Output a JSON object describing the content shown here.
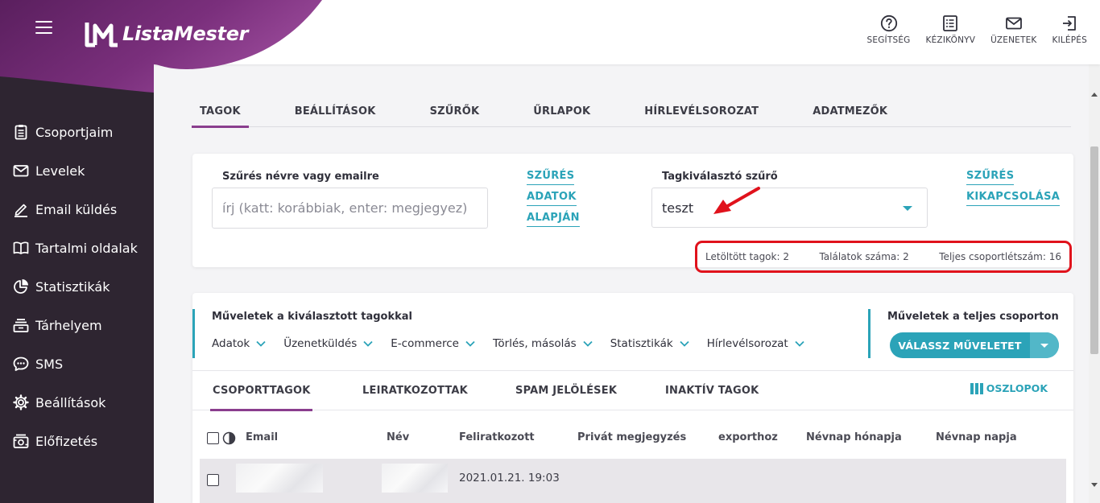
{
  "brand": {
    "name": "ListaMester",
    "wave_color": "#6d2a6f",
    "accent": "#2ba3b8",
    "tab_accent": "#8a3e8e"
  },
  "top_actions": [
    {
      "label": "SEGÍTSÉG",
      "icon": "help-circle-icon"
    },
    {
      "label": "KÉZIKÖNYV",
      "icon": "manual-icon"
    },
    {
      "label": "ÜZENETEK",
      "icon": "envelope-icon"
    },
    {
      "label": "KILÉPÉS",
      "icon": "logout-icon"
    }
  ],
  "sidebar": {
    "items": [
      {
        "label": "Csoportjaim",
        "icon": "clipboard-icon"
      },
      {
        "label": "Levelek",
        "icon": "mail-icon"
      },
      {
        "label": "Email küldés",
        "icon": "pen-icon"
      },
      {
        "label": "Tartalmi oldalak",
        "icon": "book-icon"
      },
      {
        "label": "Statisztikák",
        "icon": "pie-chart-icon"
      },
      {
        "label": "Tárhelyem",
        "icon": "storage-icon"
      },
      {
        "label": "SMS",
        "icon": "chat-bubble-icon"
      },
      {
        "label": "Beállítások",
        "icon": "gear-icon"
      },
      {
        "label": "Előfizetés",
        "icon": "subscription-icon"
      }
    ]
  },
  "main_tabs": [
    {
      "label": "TAGOK",
      "active": true
    },
    {
      "label": "BEÁLLÍTÁSOK"
    },
    {
      "label": "SZŰRŐK"
    },
    {
      "label": "ŰRLAPOK"
    },
    {
      "label": "HÍRLEVÉLSOROZAT"
    },
    {
      "label": "ADATMEZŐK"
    }
  ],
  "filter": {
    "search_label": "Szűrés névre vagy emailre",
    "search_placeholder": "írj (katt: korábbiak, enter: megjegyez)",
    "search_value": "",
    "data_filter_link": [
      "SZŰRÉS",
      "ADATOK",
      "ALAPJÁN"
    ],
    "selector_label": "Tagkiválasztó szűrő",
    "selector_value": "teszt",
    "disable_filter_link": [
      "SZŰRÉS",
      "KIKAPCSOLÁSA"
    ],
    "stats": {
      "downloaded": "Letöltött tagok: 2",
      "results": "Találatok száma: 2",
      "total": "Teljes csoportlétszám: 16"
    },
    "highlight_color": "#e0121c"
  },
  "operations": {
    "selected_title": "Műveletek a kiválasztott tagokkal",
    "selected_dropdowns": [
      "Adatok",
      "Üzenetküldés",
      "E-commerce",
      "Törlés, másolás",
      "Statisztikák",
      "Hírlevélsorozat"
    ],
    "group_title": "Műveletek a teljes csoporton",
    "group_button": "VÁLASSZ MŰVELETET"
  },
  "member_tabs": [
    {
      "label": "CSOPORTTAGOK",
      "active": true
    },
    {
      "label": "LEIRATKOZOTTAK"
    },
    {
      "label": "SPAM JELÖLÉSEK"
    },
    {
      "label": "INAKTÍV TAGOK"
    }
  ],
  "columns_button": "OSZLOPOK",
  "table": {
    "headers": [
      "Email",
      "Név",
      "Feliratkozott",
      "Privát megjegyzés",
      "exporthoz",
      "Névnap hónapja",
      "Névnap napja"
    ],
    "rows": [
      {
        "email": "",
        "name": "",
        "subscribed": "2021.01.21. 19:03"
      }
    ]
  }
}
